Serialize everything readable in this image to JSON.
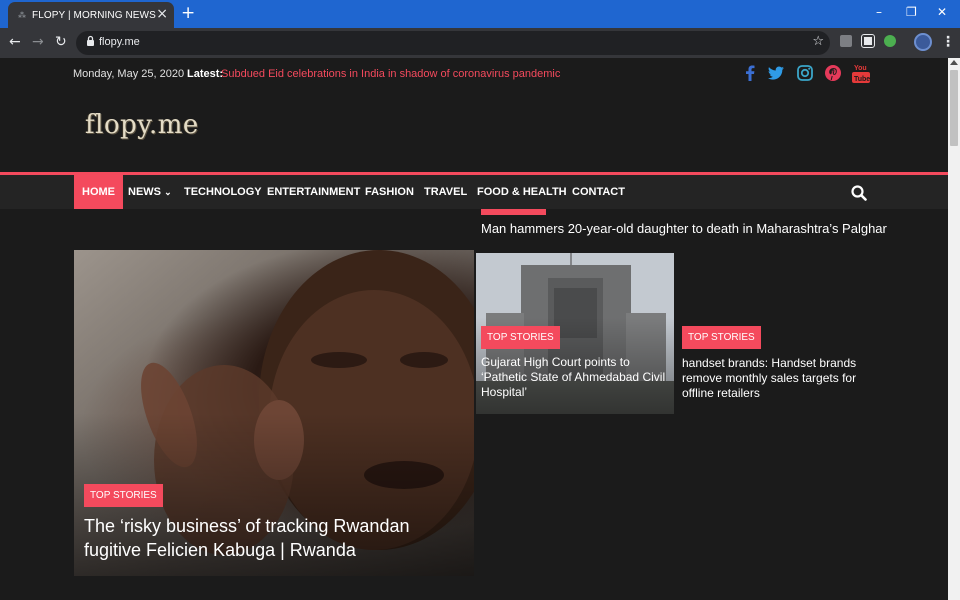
{
  "browser": {
    "tab_title": "FLOPY | MORNING NEWS",
    "url": "flopy.me"
  },
  "topbar": {
    "date": "Monday, May 25, 2020",
    "latest_label": "Latest:",
    "latest_text": "Subdued Eid celebrations in India in shadow of coronavirus pandemic",
    "social": [
      "facebook-icon",
      "twitter-icon",
      "instagram-icon",
      "pinterest-icon",
      "youtube-icon"
    ]
  },
  "site": {
    "logo": "flopy.me"
  },
  "nav": {
    "items": [
      {
        "label": "HOME",
        "active": true
      },
      {
        "label": "NEWS",
        "dropdown": true
      },
      {
        "label": "TECHNOLOGY"
      },
      {
        "label": "ENTERTAINMENT"
      },
      {
        "label": "FASHION"
      },
      {
        "label": "TRAVEL"
      },
      {
        "label": "FOOD & HEALTH"
      },
      {
        "label": "CONTACT"
      }
    ],
    "dropdown_glyph": "⌄"
  },
  "ticker_headline": "Man hammers 20-year-old daughter to death in Maharashtra’s Palghar",
  "stories": {
    "big": {
      "category": "TOP STORIES",
      "title": "The ‘risky business’ of tracking Rwandan fugitive Felicien Kabuga | Rwanda"
    },
    "mid": {
      "category": "TOP STORIES",
      "title": "Gujarat High Court points to ‘Pathetic State of Ahmedabad Civil Hospital’"
    },
    "right": {
      "category": "TOP STORIES",
      "title": "handset brands: Handset brands remove monthly sales targets for offline retailers"
    }
  },
  "colors": {
    "accent": "#f44a5d",
    "background": "#1b1b1b",
    "navbar": "#242424",
    "browser_blue": "#1f66d0"
  }
}
